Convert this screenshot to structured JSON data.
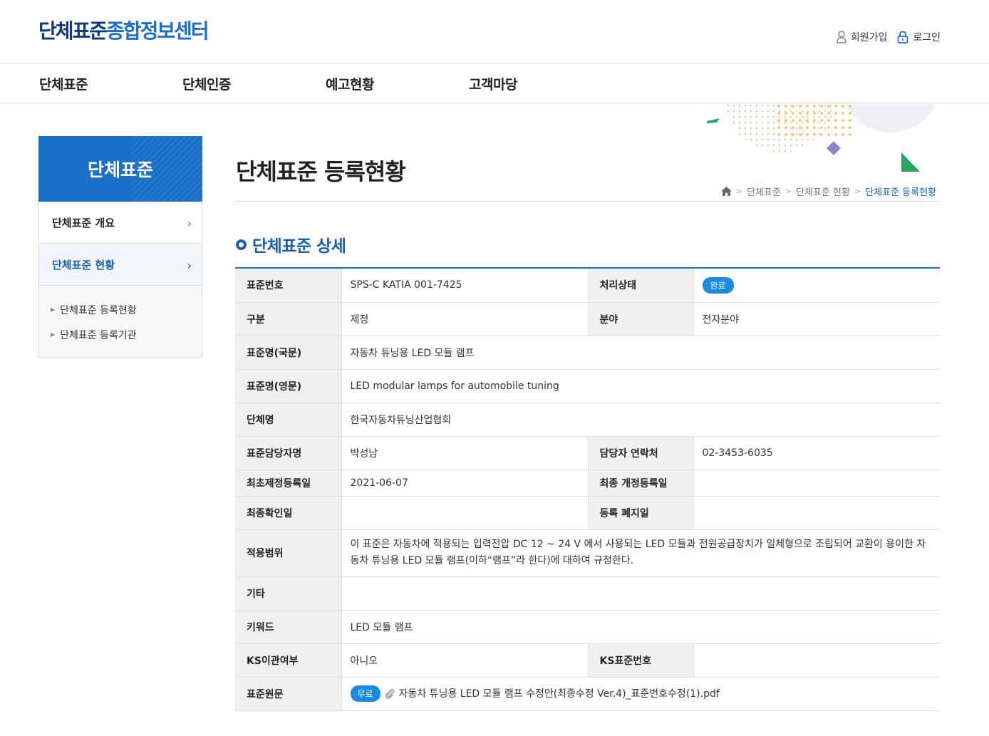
{
  "header": {
    "logo_part1": "단체표준",
    "logo_part2": "종합정보센터",
    "join_label": "회원가입",
    "login_label": "로그인"
  },
  "gnb": [
    "단체표준",
    "단체인증",
    "예고현황",
    "고객마당"
  ],
  "lnb": {
    "title": "단체표준",
    "items": [
      {
        "label": "단체표준 개요",
        "active": false
      },
      {
        "label": "단체표준 현황",
        "active": true
      }
    ],
    "sub_items": [
      "단체표준 등록현황",
      "단체표준 등록기관"
    ]
  },
  "page": {
    "title": "단체표준 등록현황",
    "breadcrumb": [
      "단체표준",
      "단체표준 현황",
      "단체표준 등록현황"
    ],
    "section_title": "단체표준 상세"
  },
  "detail": {
    "std_no_label": "표준번호",
    "std_no": "SPS-C KATIA 001-7425",
    "status_label": "처리상태",
    "status": "완료",
    "type_label": "구분",
    "type": "제정",
    "field_label": "분야",
    "field": "전자분야",
    "name_kr_label": "표준명(국문)",
    "name_kr": "자동차 튜닝용 LED 모듈 램프",
    "name_en_label": "표준명(영문)",
    "name_en": "LED modular lamps for automobile tuning",
    "org_label": "단체명",
    "org": "한국자동차튜닝산업협회",
    "manager_label": "표준담당자명",
    "manager": "박성남",
    "contact_label": "담당자 연락처",
    "contact": "02-3453-6035",
    "first_reg_label": "최초제정등록일",
    "first_reg": "2021-06-07",
    "last_reg_label": "최종 개정등록일",
    "last_reg": "",
    "final_check_label": "최종확인일",
    "final_check": "",
    "abolish_label": "등록 폐지일",
    "abolish": "",
    "scope_label": "적용범위",
    "scope": "이 표준은 자동차에 적용되는 입력전압 DC 12 ~ 24 V 에서 사용되는 LED 모듈과 전원공급장치가 일체형으로 조립되어 교환이 용이한 자동차 튜닝용 LED 모듈 램프(이하“램프”라 한다)에 대하여 규정한다.",
    "etc_label": "기타",
    "etc": "",
    "keyword_label": "키워드",
    "keyword": "LED 모듈 램프",
    "ks_label": "KS이관여부",
    "ks": "아니오",
    "ks_no_label": "KS표준번호",
    "ks_no": "",
    "original_label": "표준원문",
    "free_badge": "무료",
    "file_name": "자동차 튜닝용 LED 모듈 램프 수정안(최종수정 Ver.4)_표준번호수정(1).pdf"
  }
}
